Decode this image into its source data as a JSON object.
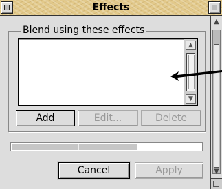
{
  "window": {
    "title": "Effects"
  },
  "group": {
    "label": "Blend using these effects"
  },
  "effects_list": {
    "items": []
  },
  "buttons": {
    "add": "Add",
    "edit": "Edit...",
    "delete": "Delete",
    "cancel": "Cancel",
    "apply": "Apply"
  },
  "progress": {
    "fraction": 0.66
  },
  "colors": {
    "titlebar": "#e2c98b",
    "window": "#dddddd",
    "disabled_text": "#999999"
  },
  "icons": {
    "back": "window-back-icon",
    "toggle": "window-toggle-size-icon",
    "pointer": "arrow-pointer-icon"
  }
}
